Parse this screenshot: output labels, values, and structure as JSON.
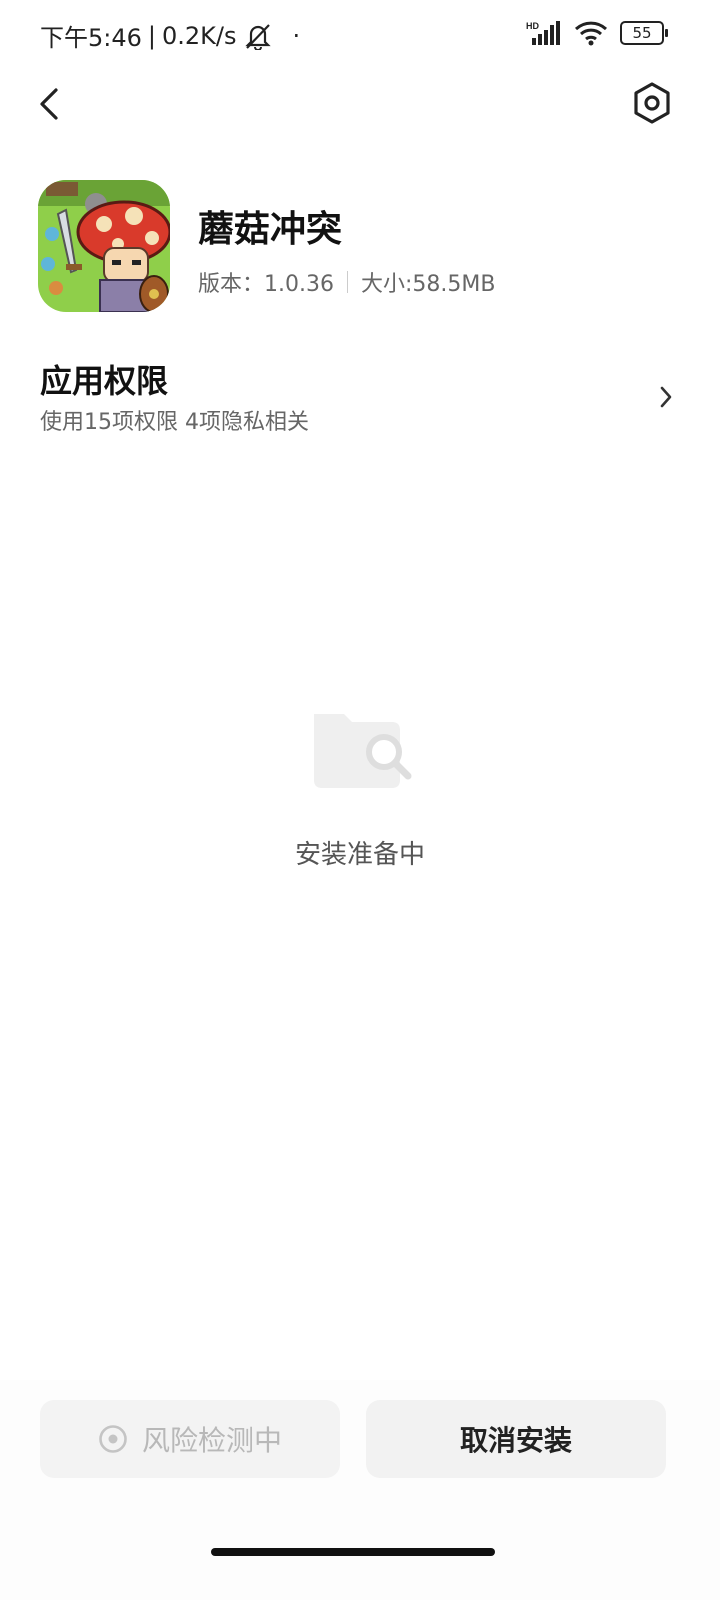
{
  "status_bar": {
    "time": "下午5:46",
    "separator": "|",
    "net_speed": "0.2K/s",
    "dot": "·",
    "battery": "55",
    "hd_label": "HD"
  },
  "header": {
    "back_icon": "chevron-left-icon",
    "settings_icon": "hexagon-settings-icon"
  },
  "app": {
    "name": "蘑菇冲突",
    "version": "版本：1.0.36",
    "size": "大小:58.5MB"
  },
  "permissions": {
    "title": "应用权限",
    "subtitle": "使用15项权限 4项隐私相关"
  },
  "status": {
    "preparing": "安装准备中"
  },
  "buttons": {
    "risk_check": "风险检测中",
    "cancel_install": "取消安装"
  },
  "colors": {
    "background": "#ffffff",
    "disabled_text": "#b8b8b8",
    "button_bg": "#f2f2f2"
  }
}
